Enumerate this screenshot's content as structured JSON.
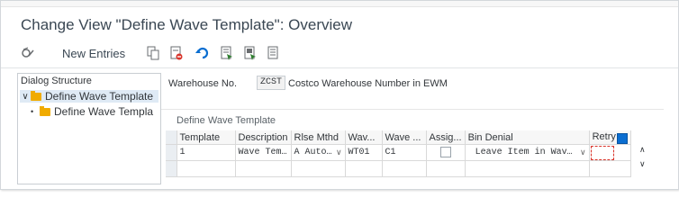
{
  "window": {
    "title": "Change View \"Define Wave Template\": Overview"
  },
  "toolbar": {
    "new_entries_label": "New Entries",
    "icons": [
      "display-change-icon",
      "copy-icon",
      "delete-icon",
      "undo-icon",
      "select-all-icon",
      "select-block-icon",
      "deselect-all-icon"
    ]
  },
  "sidebar": {
    "header": "Dialog Structure",
    "items": [
      {
        "label": "Define Wave Template",
        "expanded": true,
        "selected": true
      },
      {
        "label": "Define Wave Templa",
        "expanded": false,
        "selected": false
      }
    ]
  },
  "main": {
    "warehouse_label": "Warehouse No.",
    "warehouse_value": "ZCST",
    "warehouse_desc": "Costco Warehouse Number in EWM",
    "group_title": "Define Wave Template",
    "columns": [
      "Template",
      "Description",
      "Rlse Mthd",
      "Wav...",
      "Wave ...",
      "Assig...",
      "Bin Denial",
      "Retry"
    ],
    "rows": [
      {
        "template": "1",
        "description": "Wave Tem…",
        "rlse_mthd": "A Auto…",
        "wav": "WT01",
        "wave": "C1",
        "assig": false,
        "bin_denial": "Leave Item in Wav…",
        "retry": ""
      },
      {
        "template": "",
        "description": "",
        "rlse_mthd": "",
        "wav": "",
        "wave": "",
        "assig": null,
        "bin_denial": "",
        "retry": ""
      }
    ]
  },
  "colors": {
    "folder": "#f0ab00",
    "accent": "#0a6ed1",
    "focus": "#d9342b"
  }
}
